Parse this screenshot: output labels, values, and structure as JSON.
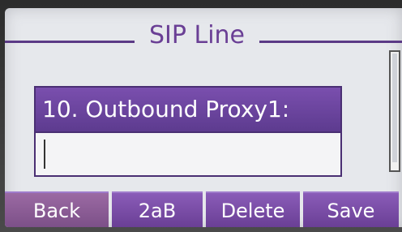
{
  "screen": {
    "title": "SIP Line"
  },
  "field": {
    "label": "10. Outbound Proxy1:",
    "value": ""
  },
  "softkeys": [
    {
      "label": "Back"
    },
    {
      "label": "2aB"
    },
    {
      "label": "Delete"
    },
    {
      "label": "Save"
    }
  ],
  "colors": {
    "accent": "#6a3f95",
    "screen_bg": "#e6e8ec",
    "text_on_accent": "#ffffff"
  }
}
